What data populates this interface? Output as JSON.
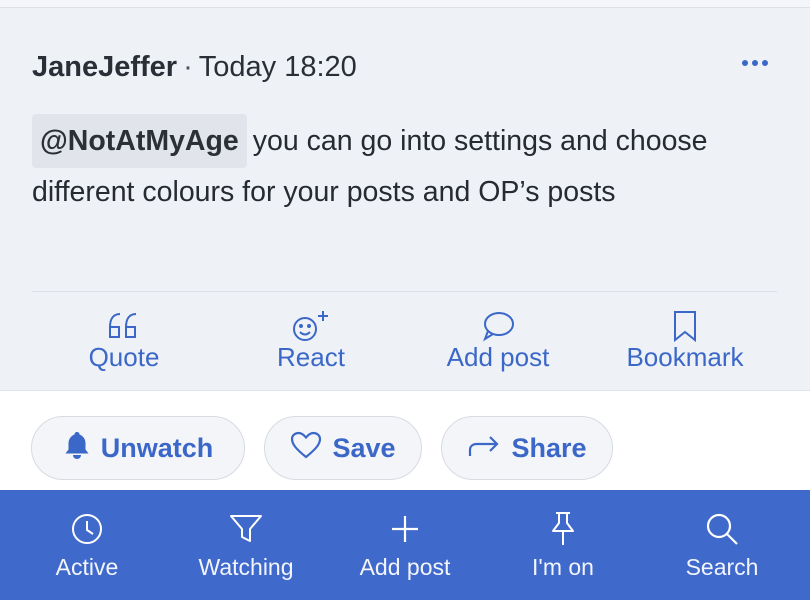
{
  "post": {
    "author": "JaneJeffer",
    "separator": "·",
    "timestamp": "Today 18:20",
    "mention": "@NotAtMyAge",
    "body": "you can go into settings and choose different colours for your posts and OP’s posts"
  },
  "actions": {
    "quote": "Quote",
    "react": "React",
    "add_post": "Add post",
    "bookmark": "Bookmark"
  },
  "buttons": {
    "unwatch": "Unwatch",
    "save": "Save",
    "share": "Share"
  },
  "tabbar": {
    "active": "Active",
    "watching": "Watching",
    "add_post": "Add post",
    "im_on": "I'm on",
    "search": "Search"
  },
  "colors": {
    "accent": "#3b68c8",
    "tabbar_bg": "#4069cc",
    "card_bg": "#eef1f6"
  },
  "icons": {
    "more": "more-dots-icon",
    "quote": "quote-icon",
    "react": "smiley-plus-icon",
    "add_post": "speech-bubble-icon",
    "bookmark": "bookmark-icon",
    "unwatch": "bell-icon",
    "save": "heart-icon",
    "share": "share-arrow-icon",
    "active": "clock-icon",
    "watching": "filter-icon",
    "tab_add_post": "plus-icon",
    "im_on": "pin-icon",
    "search": "magnifier-icon"
  }
}
